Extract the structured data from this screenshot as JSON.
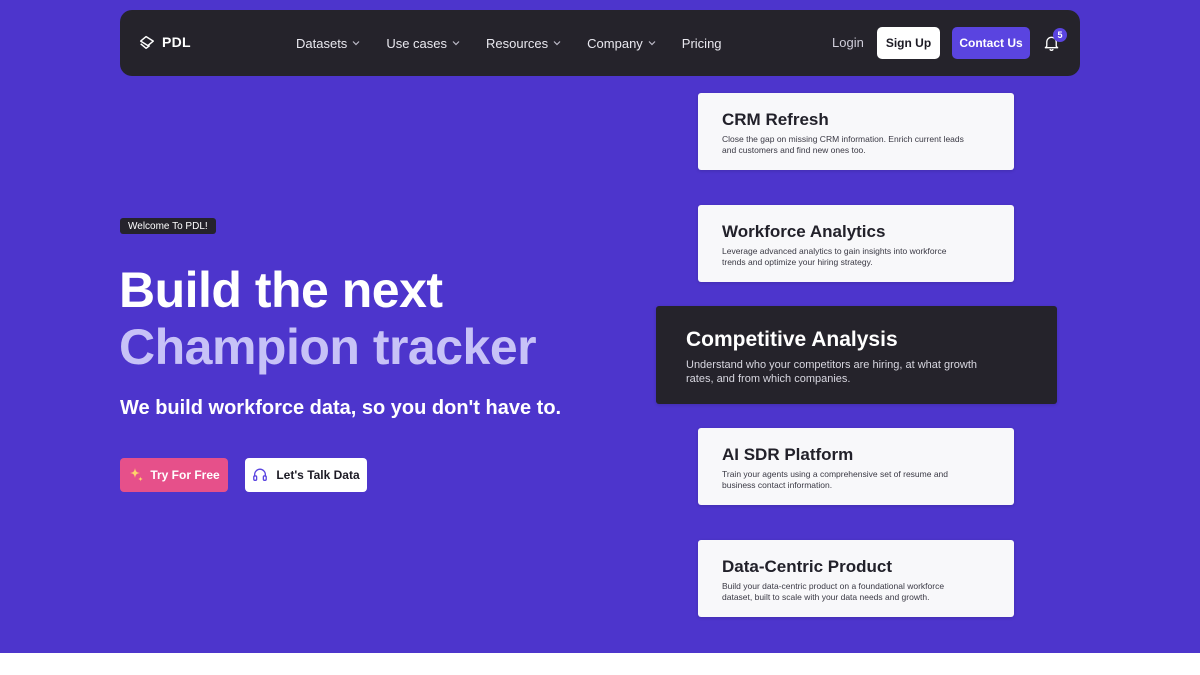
{
  "nav": {
    "logo_text": "PDL",
    "links": [
      {
        "label": "Datasets",
        "dropdown": true
      },
      {
        "label": "Use cases",
        "dropdown": true
      },
      {
        "label": "Resources",
        "dropdown": true
      },
      {
        "label": "Company",
        "dropdown": true
      },
      {
        "label": "Pricing",
        "dropdown": false
      }
    ],
    "login_label": "Login",
    "signup_label": "Sign Up",
    "contact_label": "Contact Us",
    "notification_count": "5"
  },
  "hero": {
    "badge": "Welcome To PDL!",
    "headline_line1": "Build the next",
    "headline_line2": "Champion tracker",
    "subheadline": "We build workforce data, so you don't have to.",
    "cta_primary": "Try For Free",
    "cta_secondary": "Let's Talk Data"
  },
  "use_cases": [
    {
      "title": "CRM Refresh",
      "description": "Close the gap on missing CRM information. Enrich current leads and customers and find new ones too."
    },
    {
      "title": "Workforce Analytics",
      "description": "Leverage advanced analytics to gain insights into workforce trends and optimize your hiring strategy."
    },
    {
      "title": "Competitive Analysis",
      "description": "Understand who your competitors are hiring, at what growth rates, and from which companies."
    },
    {
      "title": "AI SDR Platform",
      "description": "Train your agents using a comprehensive set of resume and business contact information."
    },
    {
      "title": "Data-Centric Product",
      "description": "Build your data-centric product on a foundational workforce dataset, built to scale with your data needs and growth."
    }
  ],
  "colors": {
    "hero_bg": "#4d35cc",
    "nav_bg": "#25232b",
    "accent": "#5a44e0",
    "cta_pink": "#e6508a",
    "headline_highlight": "#c7c2f7"
  },
  "icons": {
    "logo": "pdl-logo-icon",
    "dropdown": "chevron-down-icon",
    "notification": "bell-icon",
    "cta_primary": "sparkle-icon",
    "cta_secondary": "headset-icon"
  }
}
